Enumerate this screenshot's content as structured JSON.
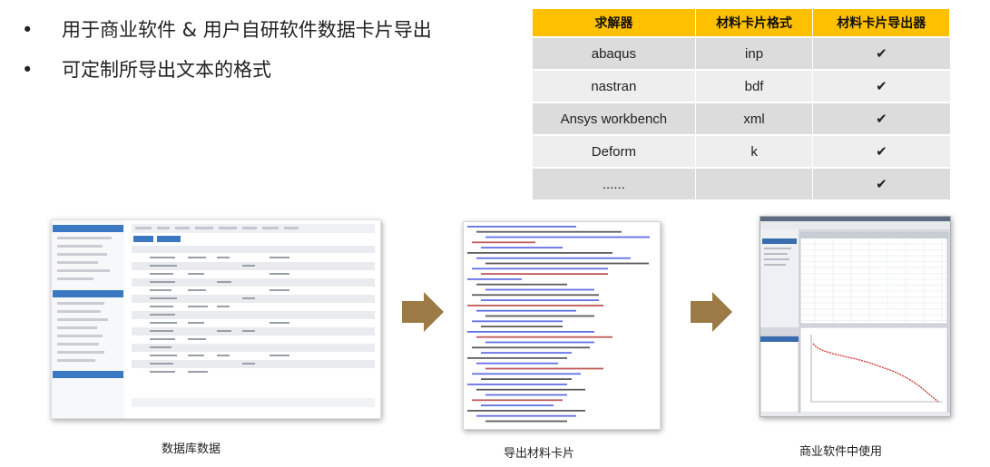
{
  "bullets": [
    {
      "text": "用于商业软件 & 用户自研软件数据卡片导出"
    },
    {
      "text": "可定制所导出文本的格式"
    }
  ],
  "solver_table": {
    "headers": [
      "求解器",
      "材料卡片格式",
      "材料卡片导出器"
    ],
    "rows": [
      {
        "solver": "abaqus",
        "format": "inp",
        "exporter": "✔"
      },
      {
        "solver": "nastran",
        "format": "bdf",
        "exporter": "✔"
      },
      {
        "solver": "Ansys workbench",
        "format": "xml",
        "exporter": "✔"
      },
      {
        "solver": "Deform",
        "format": "k",
        "exporter": "✔"
      },
      {
        "solver": "......",
        "format": "",
        "exporter": "✔"
      }
    ],
    "header_color": "#ffc000"
  },
  "captions": {
    "database": "数据库数据",
    "export": "导出材料卡片",
    "commercial": "商业软件中使用"
  },
  "colors": {
    "arrow": "#9b7a45",
    "db_header_blue": "#3a78c2",
    "xml_tag_blue": "#3b4ce0",
    "curve_red": "#d23a3a"
  }
}
